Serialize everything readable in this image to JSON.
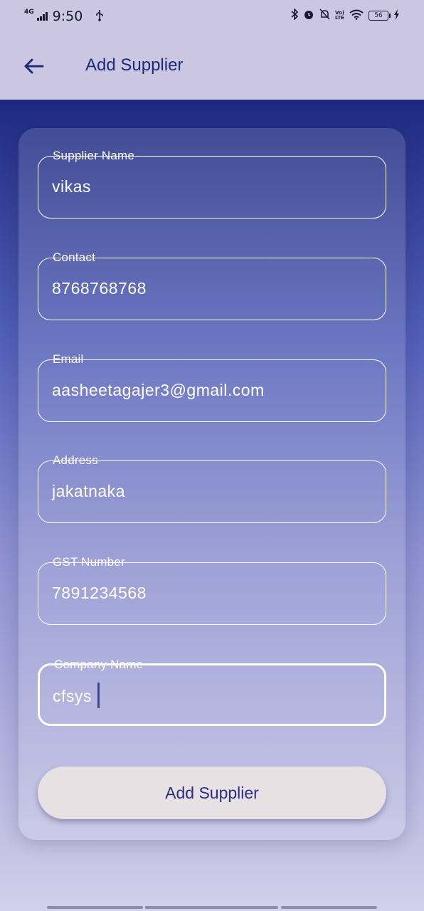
{
  "status_bar": {
    "network_type": "4G",
    "time": "9:50",
    "usb_icon": "usb-icon",
    "volte_line1": "Vo)",
    "volte_line2": "LTE",
    "battery_level": "56"
  },
  "app_bar": {
    "back_icon": "arrow-left-icon",
    "title": "Add Supplier"
  },
  "colors": {
    "accent": "#1f2a7a",
    "gradient_top": "#1e2a80",
    "gradient_bottom": "#d3d0ea",
    "button_bg": "#e7e1e3"
  },
  "form": {
    "fields": [
      {
        "label": "Supplier Name",
        "value": "vikas"
      },
      {
        "label": "Contact",
        "value": "8768768768"
      },
      {
        "label": "Email",
        "value": "aasheetagajer3@gmail.com"
      },
      {
        "label": "Address",
        "value": "jakatnaka"
      },
      {
        "label": "GST Number",
        "value": "7891234568"
      },
      {
        "label": "Company Name",
        "value": "cfsys"
      }
    ],
    "submit_label": "Add Supplier"
  }
}
